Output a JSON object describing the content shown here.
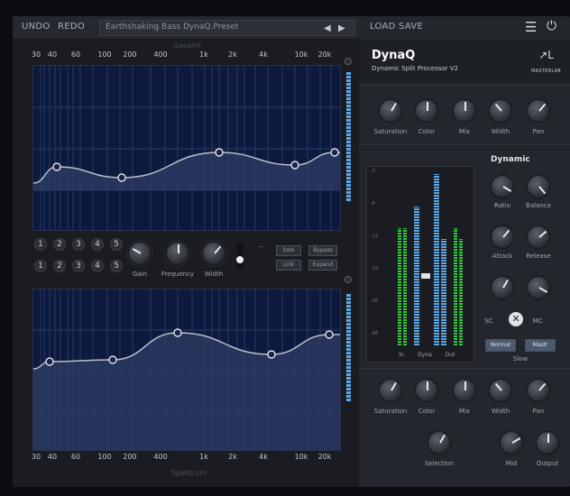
{
  "toolbar": {
    "undo": "UNDO",
    "redo": "REDO",
    "preset": "Earthshaking Bass DynaQ.Preset",
    "prev": "◀",
    "next": "▶",
    "load": "LOAD",
    "save": "SAVE",
    "menu_icon": "☰",
    "power_icon": "⏻"
  },
  "eq": {
    "top_label": "Gesamt",
    "bottom_label": "Spektrum",
    "freq_labels": [
      "30",
      "40",
      "60",
      "100",
      "200",
      "400",
      "1k",
      "2k",
      "4k",
      "10k",
      "20k"
    ],
    "bands_row1": [
      "1",
      "2",
      "3",
      "4",
      "5"
    ],
    "bands_row2": [
      "1",
      "2",
      "3",
      "4",
      "5"
    ],
    "knobs": [
      {
        "label": "Gain"
      },
      {
        "label": "Frequency"
      },
      {
        "label": "Width"
      }
    ],
    "buttons": [
      "Solo",
      "Bypass",
      "Link",
      "Expand"
    ],
    "upper_curve_color": "#b8bfcc",
    "fill_color": "#2f3d66"
  },
  "plugin": {
    "title": "DynaQ",
    "subtitle": "Dynamic Split Processor V2",
    "brand": "MASTERLAB",
    "brand_logo": "↗L",
    "top_knobs": [
      {
        "label": "Saturation"
      },
      {
        "label": "Color"
      },
      {
        "label": "Mix"
      },
      {
        "label": "Width"
      },
      {
        "label": "Pan"
      }
    ],
    "dynamic_title": "Dynamic",
    "dynamic_knobs": [
      {
        "label": "Ratio"
      },
      {
        "label": "Balance"
      },
      {
        "label": "Attack"
      },
      {
        "label": "Release"
      }
    ],
    "sc_label": "SC",
    "mc_label": "MC",
    "slow_label": "Slow",
    "side_btn_a": "Normal",
    "side_btn_b": "Mastr",
    "meters": {
      "labels": [
        "In",
        "Dyna",
        "Out"
      ],
      "scale": [
        "-0",
        "-6",
        "-12",
        "-24",
        "-36",
        "-48"
      ]
    },
    "bottom_knobs": [
      {
        "label": "Saturation"
      },
      {
        "label": "Color"
      },
      {
        "label": "Mix"
      },
      {
        "label": "Width"
      },
      {
        "label": "Pan"
      }
    ],
    "footer_knobs": [
      {
        "label": "Selection"
      },
      {
        "label": "Mid"
      },
      {
        "label": "Output"
      }
    ],
    "meter_colors": {
      "green": "#2fc93a",
      "blue": "#5aa8e8"
    }
  }
}
